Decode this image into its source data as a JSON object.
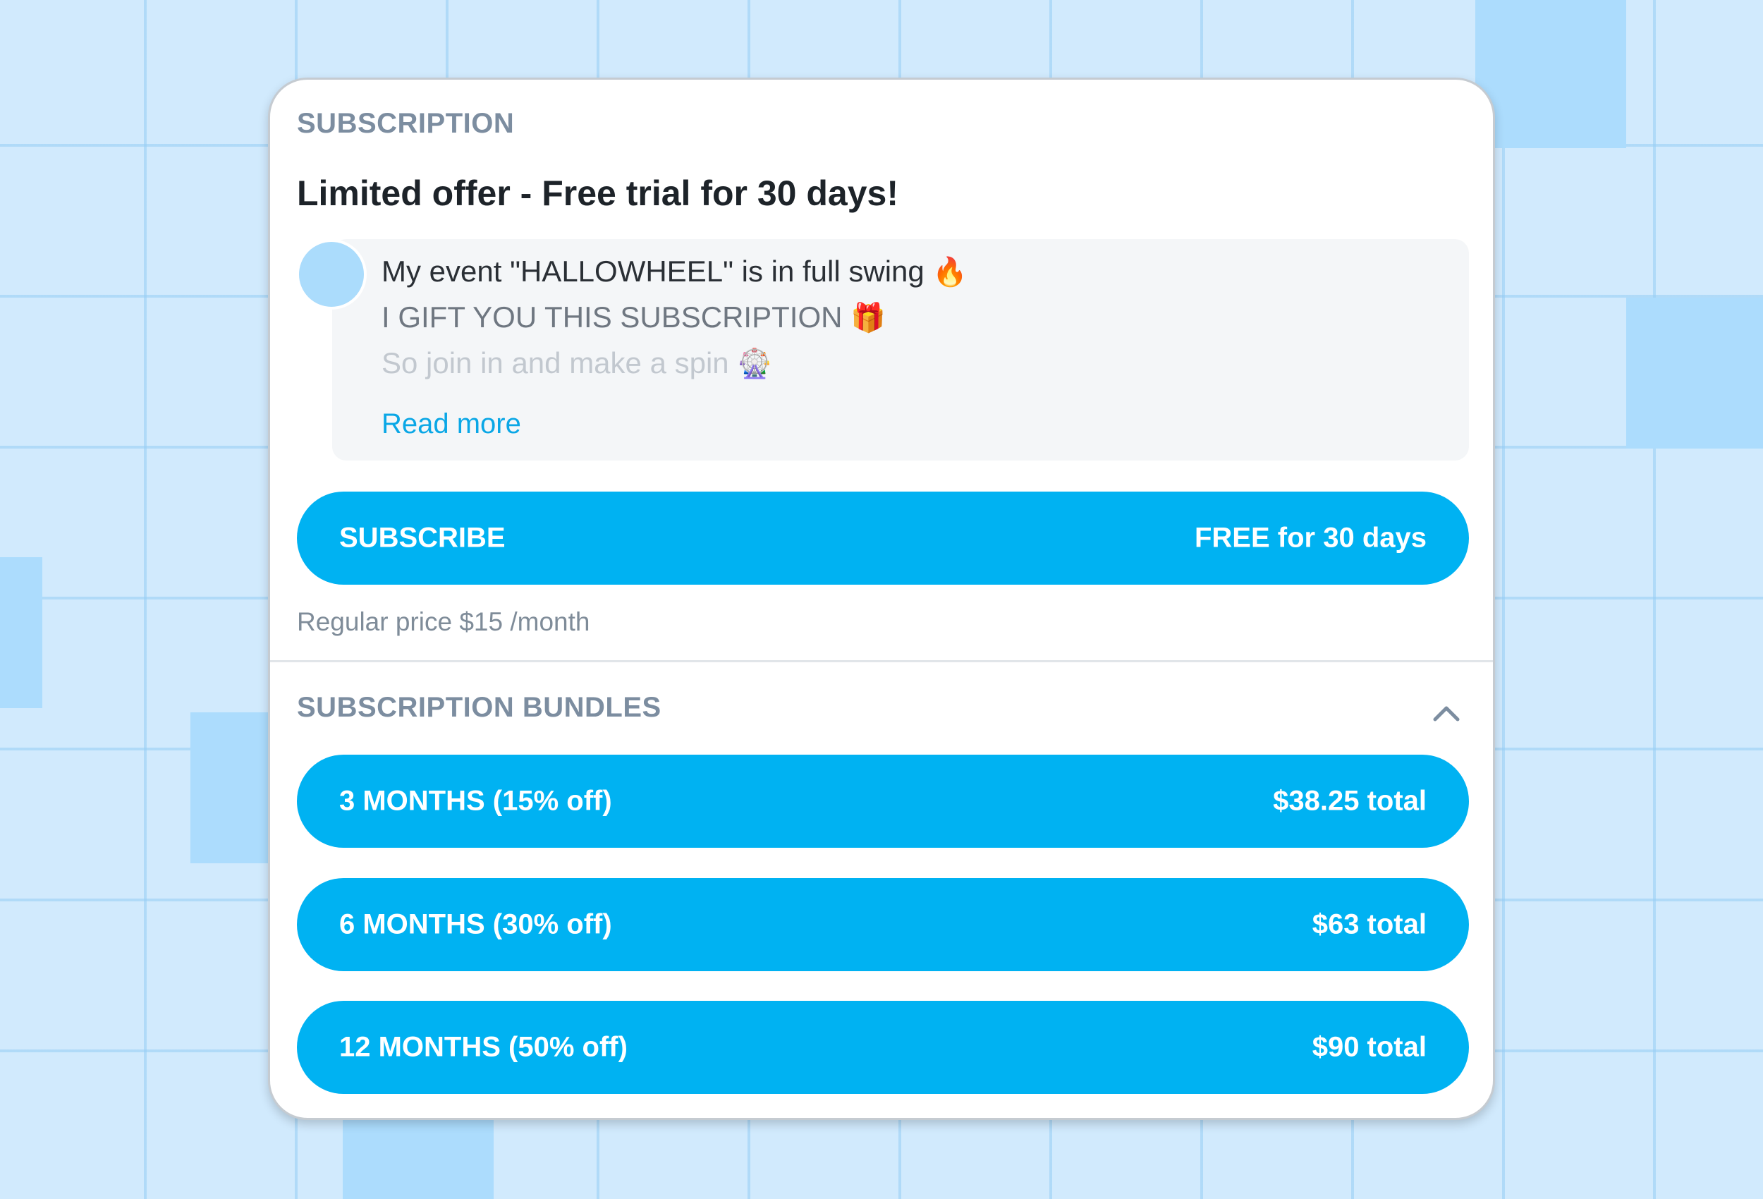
{
  "subscription": {
    "label": "SUBSCRIPTION",
    "title": "Limited offer - Free trial for 30 days!",
    "message": {
      "line1": "My event \"HALLOWHEEL\" is in full swing",
      "line1_emoji": "🔥",
      "line2": "I GIFT YOU THIS SUBSCRIPTION",
      "line2_emoji": "🎁",
      "line3": "So join in and make a spin",
      "line3_emoji": "🎡",
      "read_more": "Read more"
    },
    "subscribe_button": {
      "label": "SUBSCRIBE",
      "price": "FREE for 30 days"
    },
    "regular_price": "Regular price $15 /month"
  },
  "bundles": {
    "label": "SUBSCRIPTION BUNDLES",
    "toggle_icon": "chevron-up-icon",
    "items": [
      {
        "label": "3 MONTHS (15% off)",
        "price": "$38.25 total"
      },
      {
        "label": "6 MONTHS (30% off)",
        "price": "$63 total"
      },
      {
        "label": "12 MONTHS (50% off)",
        "price": "$90 total"
      }
    ]
  },
  "colors": {
    "background": "#d1eafd",
    "accent": "#00b2f2",
    "link": "#0aa7e6",
    "label_gray": "#7c8da0"
  }
}
